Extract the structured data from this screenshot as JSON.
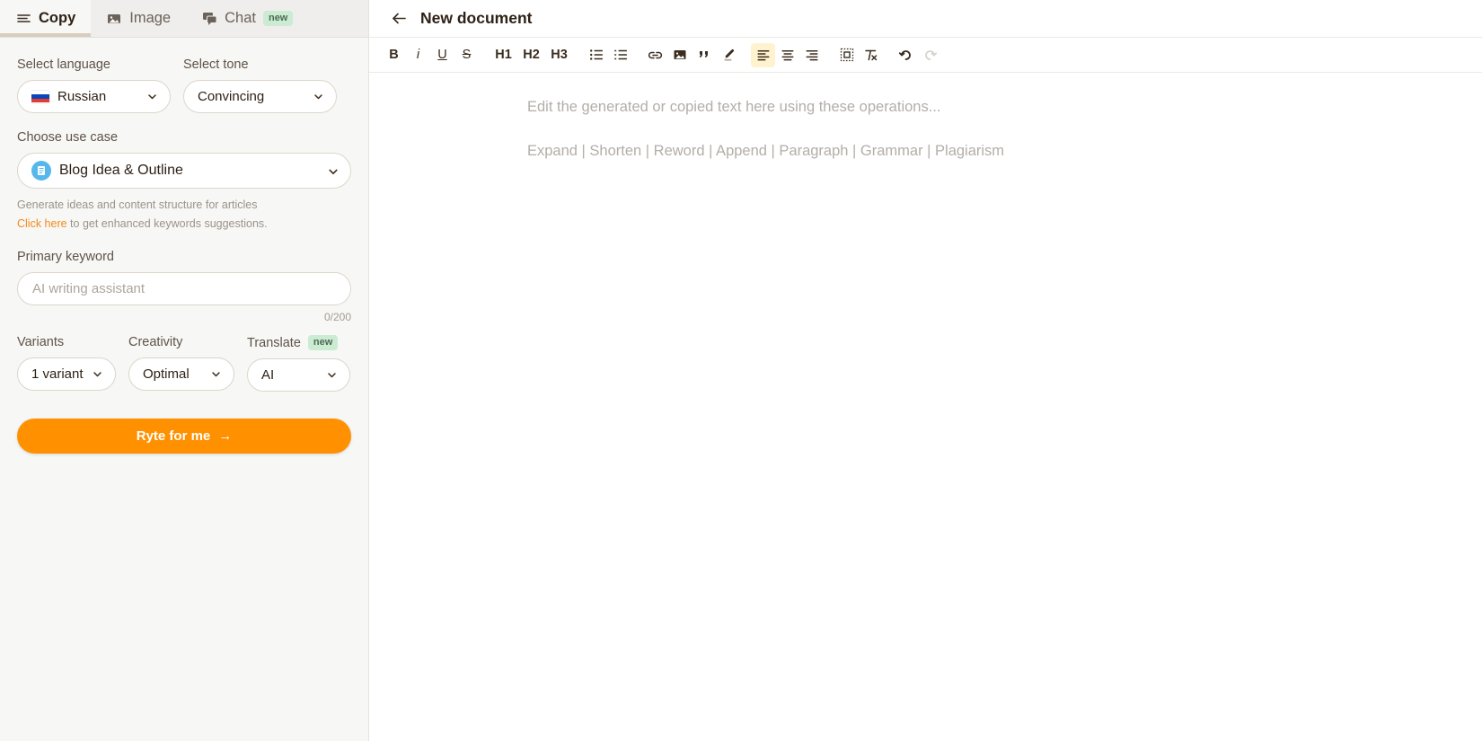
{
  "tabs": [
    {
      "label": "Copy",
      "icon": "menu-icon",
      "active": true,
      "badge": null
    },
    {
      "label": "Image",
      "icon": "image-icon",
      "active": false,
      "badge": null
    },
    {
      "label": "Chat",
      "icon": "chat-icon",
      "active": false,
      "badge": "new"
    }
  ],
  "sidebar": {
    "language": {
      "label": "Select language",
      "value": "Russian",
      "flag": "russia-flag-icon"
    },
    "tone": {
      "label": "Select tone",
      "value": "Convincing"
    },
    "use_case": {
      "label": "Choose use case",
      "value": "Blog Idea & Outline",
      "icon": "document-outline-icon",
      "description": "Generate ideas and content structure for articles",
      "link_text": "Click here",
      "link_rest": " to get enhanced keywords suggestions."
    },
    "primary_keyword": {
      "label": "Primary keyword",
      "value": "",
      "placeholder": "AI writing assistant",
      "counter": "0/200"
    },
    "variants": {
      "label": "Variants",
      "value": "1 variant"
    },
    "creativity": {
      "label": "Creativity",
      "value": "Optimal"
    },
    "translate": {
      "label": "Translate",
      "badge": "new",
      "value": "AI"
    },
    "cta": {
      "label": "Ryte for me",
      "arrow": "→"
    }
  },
  "document": {
    "back": "back-arrow-icon",
    "title": "New document",
    "toolbar": [
      {
        "name": "bold-button",
        "label": "B"
      },
      {
        "name": "italic-button",
        "label": "i"
      },
      {
        "name": "underline-button",
        "label": "U"
      },
      {
        "name": "strikethrough-button",
        "label": "S"
      },
      {
        "name": "heading-1-button",
        "label": "H1"
      },
      {
        "name": "heading-2-button",
        "label": "H2"
      },
      {
        "name": "heading-3-button",
        "label": "H3"
      },
      {
        "name": "bullet-list-button",
        "label": ""
      },
      {
        "name": "numbered-list-button",
        "label": ""
      },
      {
        "name": "link-button",
        "label": ""
      },
      {
        "name": "image-button",
        "label": ""
      },
      {
        "name": "quote-button",
        "label": ""
      },
      {
        "name": "highlight-button",
        "label": ""
      },
      {
        "name": "align-left-button",
        "label": ""
      },
      {
        "name": "align-center-button",
        "label": ""
      },
      {
        "name": "align-right-button",
        "label": ""
      },
      {
        "name": "frame-button",
        "label": ""
      },
      {
        "name": "clear-format-button",
        "label": ""
      },
      {
        "name": "undo-button",
        "label": ""
      },
      {
        "name": "redo-button",
        "label": ""
      }
    ],
    "editor": {
      "placeholder": "Edit the generated or copied text here using these operations...",
      "operations": "Expand | Shorten | Reword | Append | Paragraph | Grammar | Plagiarism"
    }
  },
  "colors": {
    "accent_orange": "#FF9100",
    "link_orange": "#F38A1B",
    "badge_green_bg": "#CBEBD2",
    "active_tool_bg": "#FEF3CE",
    "sidebar_bg": "#F7F7F5",
    "text_dark": "#2E2116"
  }
}
